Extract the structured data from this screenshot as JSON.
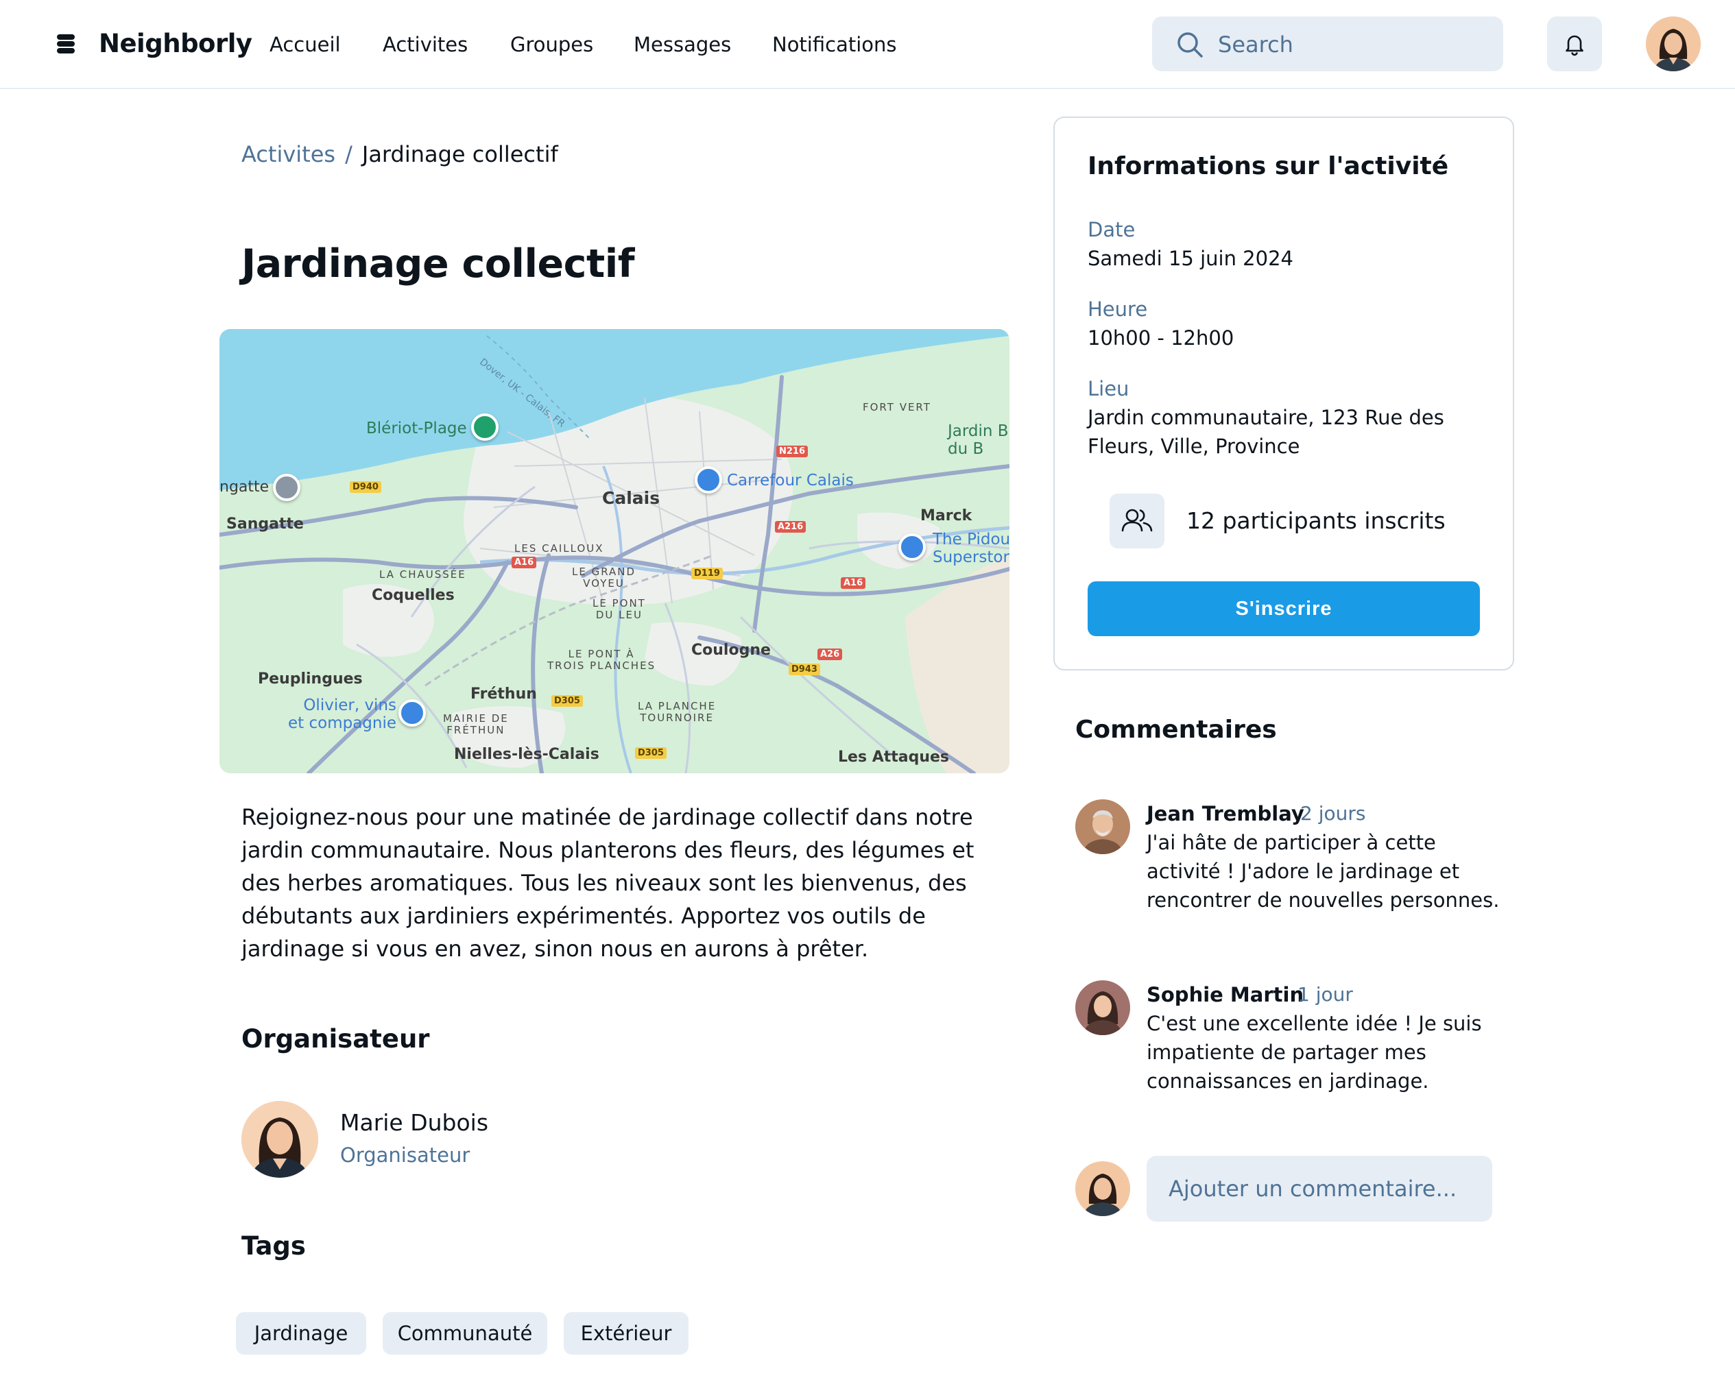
{
  "header": {
    "brand": "Neighborly",
    "nav": [
      "Accueil",
      "Activites",
      "Groupes",
      "Messages",
      "Notifications"
    ],
    "search_placeholder": "Search"
  },
  "breadcrumb": {
    "parent": "Activites",
    "separator": "/",
    "current": "Jardinage collectif"
  },
  "activity": {
    "title": "Jardinage collectif",
    "description": "Rejoignez-nous pour une matinée de jardinage collectif dans notre jardin communautaire. Nous planterons des fleurs, des légumes et des herbes aromatiques. Tous les niveaux sont les bienvenus, des débutants aux jardiniers expérimentés. Apportez vos outils de jardinage si vous en avez, sinon nous en aurons à prêter."
  },
  "map": {
    "labels": {
      "calais": "Calais",
      "sangatte": "Sangatte",
      "ngatte": "ngatte",
      "coquelles": "Coquelles",
      "coulogne": "Coulogne",
      "marck": "Marck",
      "peuplingues": "Peuplingues",
      "frethun": "Fréthun",
      "nielles": "Nielles-lès-Calais",
      "attaques": "Les Attaques",
      "fort_vert": "FORT VERT",
      "cailloux": "LES CAILLOUX",
      "chaussee": "LA CHAUSSÉE",
      "grand_voyeu": "LE GRAND\nVOYEU",
      "pont_du_leu": "LE PONT\nDU LEU",
      "pont_trois": "LE PONT À\nTROIS PLANCHES",
      "planche": "LA PLANCHE\nTOURNOIRE",
      "mairie": "MAIRIE DE\nFRÉTHUN",
      "bleriot": "Blériot-Plage",
      "carrefour": "Carrefour Calais",
      "pidou": "The Pidou\nSuperstore",
      "olivier": "Olivier, vins\net compagnie",
      "jardin": "Jardin B\ndu B",
      "ferry": "Dover, UK - Calais, FR"
    },
    "roads": {
      "n216": "N216",
      "a216": "A216",
      "a16a": "A16",
      "a16b": "A16",
      "a26": "A26",
      "d940": "D940",
      "d119": "D119",
      "d943": "D943",
      "d305a": "D305",
      "d305b": "D305"
    }
  },
  "organizer": {
    "section_title": "Organisateur",
    "name": "Marie Dubois",
    "role": "Organisateur"
  },
  "tags": {
    "section_title": "Tags",
    "items": [
      "Jardinage",
      "Communauté",
      "Extérieur"
    ]
  },
  "info": {
    "title": "Informations sur l'activité",
    "date_label": "Date",
    "date_value": "Samedi 15 juin 2024",
    "time_label": "Heure",
    "time_value": "10h00 - 12h00",
    "place_label": "Lieu",
    "place_value": "Jardin communautaire, 123 Rue des Fleurs, Ville, Province",
    "participants": "12 participants inscrits",
    "signup_label": "S'inscrire"
  },
  "comments": {
    "section_title": "Commentaires",
    "items": [
      {
        "author": "Jean Tremblay",
        "time": "2 jours",
        "text": "J'ai hâte de participer à cette activité ! J'adore le jardinage et rencontrer de nouvelles personnes."
      },
      {
        "author": "Sophie Martin",
        "time": "1 jour",
        "text": "C'est une excellente idée ! Je suis impatiente de partager mes connaissances en jardinage."
      }
    ],
    "input_placeholder": "Ajouter un commentaire..."
  },
  "colors": {
    "accent": "#1a9be6",
    "muted_text": "#4e7397",
    "surface": "#e7edf4",
    "text": "#0d141c"
  },
  "icons": {
    "logo": "stack-logo-icon",
    "search": "search-icon",
    "notifications": "bell-icon",
    "participants": "users-icon"
  }
}
